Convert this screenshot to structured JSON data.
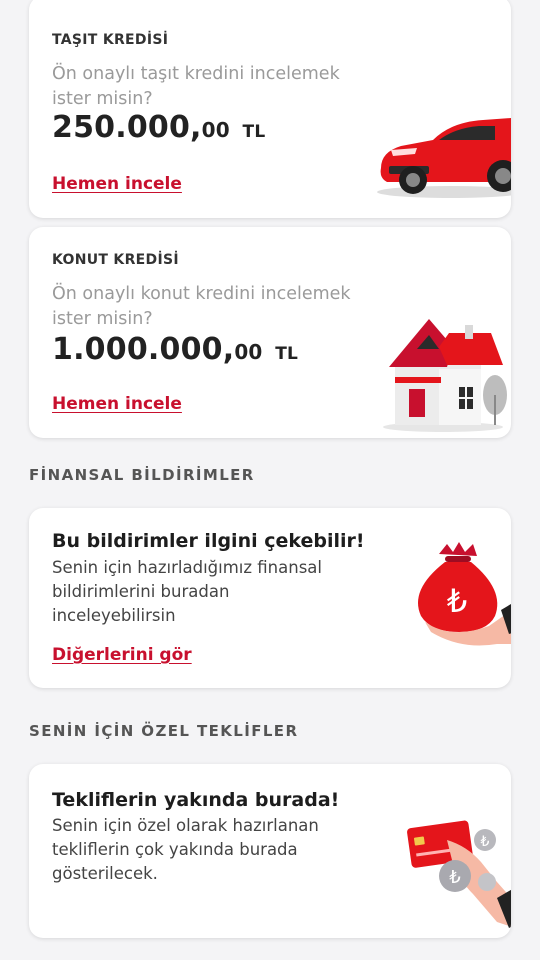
{
  "vehicle_loan": {
    "title": "TAŞIT KREDİSİ",
    "description": "Ön onaylı taşıt kredini incelemek ister misin?",
    "amount_main": "250.000,",
    "amount_cents": "00",
    "currency": "TL",
    "link": "Hemen incele"
  },
  "housing_loan": {
    "title": "KONUT KREDİSİ",
    "description": "Ön onaylı konut kredini incelemek ister misin?",
    "amount_main": "1.000.000,",
    "amount_cents": "00",
    "currency": "TL",
    "link": "Hemen incele"
  },
  "financial_notifications": {
    "section_title": "FİNANSAL BİLDİRİMLER",
    "card_title": "Bu bildirimler ilgini çekebilir!",
    "description": "Senin için hazırladığımız finansal bildirimlerini buradan inceleyebilirsin",
    "link": "Diğerlerini gör"
  },
  "special_offers": {
    "section_title": "SENİN İÇİN ÖZEL TEKLİFLER",
    "card_title": "Tekliflerin yakında burada!",
    "description": "Senin için özel olarak hazırlanan tekliflerin çok yakında burada gösterilecek."
  },
  "colors": {
    "accent": "#c8102e",
    "background": "#f4f4f6",
    "card": "#ffffff"
  },
  "icons": [
    "car-icon",
    "house-icon",
    "money-bag-icon",
    "credit-card-coins-icon"
  ]
}
